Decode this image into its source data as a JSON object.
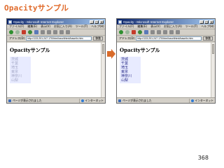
{
  "slide": {
    "title": "Opacityサンプル",
    "page_number": "368"
  },
  "windows": [
    {
      "titlebar_text": "Opacity - Microsoft Internet Explorer",
      "menu": [
        "ファイル(F)",
        "編集(E)",
        "表示(V)",
        "お気に入り(A)",
        "ツール(T)",
        "ヘルプ(H)"
      ],
      "address_label": "アドレス(D)",
      "address_value": "http://133.201.247.170/html/sev/dhtml/base/tv.htm",
      "go_label": "移動",
      "heading": "Opacityサンプル",
      "prefectures": [
        "茨城",
        "千葉",
        "埼玉",
        "東京",
        "神奈川",
        "山梨"
      ],
      "status_text": "ページが表示されました",
      "zone_text": "インターネット"
    },
    {
      "titlebar_text": "Opacity - Microsoft Internet Explorer",
      "menu": [
        "ファイル(F)",
        "編集(E)",
        "表示(V)",
        "お気に入り(A)",
        "ツール(T)",
        "ヘルプ(H)"
      ],
      "address_label": "アドレス(D)",
      "address_value": "http://133.201.247.170/html/sev/dhtml/base/tv.htm",
      "go_label": "移動",
      "heading": "Opacityサンプル",
      "prefectures": [
        "茨城",
        "千葉",
        "埼玉",
        "東京",
        "神奈川",
        "山梨"
      ],
      "status_text": "ページが表示されました",
      "zone_text": "インターネット"
    }
  ],
  "colors": {
    "title_accent": "#e06a2a",
    "arrow": "#d96b2a",
    "faded_text": "#a6a9c8",
    "opaque_text": "#2b2e8a",
    "list_bg": "#e8ebff"
  },
  "icons": {
    "toolbar": [
      "back-icon",
      "forward-icon",
      "stop-icon",
      "refresh-icon",
      "home-icon",
      "search-icon",
      "favorites-icon",
      "history-icon",
      "mail-icon",
      "print-icon"
    ],
    "arrow": "right-arrow-icon"
  }
}
